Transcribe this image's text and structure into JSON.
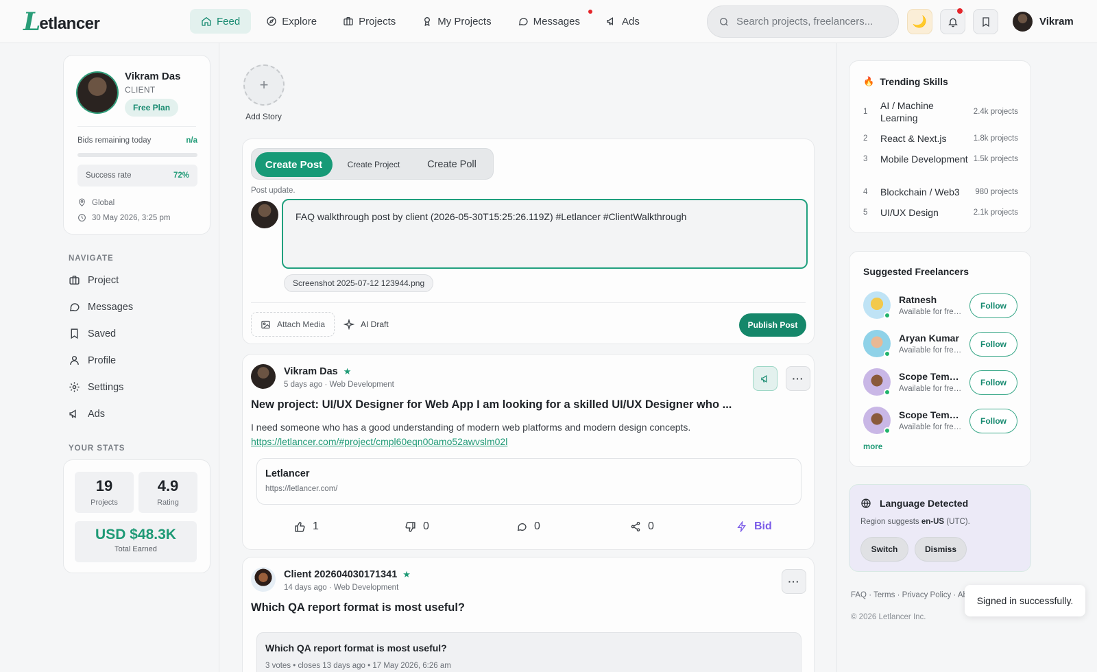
{
  "brand": {
    "logo_initial": "L",
    "logo_rest": "etlancer"
  },
  "nav": {
    "items": [
      {
        "label": "Feed",
        "icon": "home-icon",
        "active": true
      },
      {
        "label": "Explore",
        "icon": "compass-icon"
      },
      {
        "label": "Projects",
        "icon": "briefcase-icon"
      },
      {
        "label": "My Projects",
        "icon": "award-icon"
      },
      {
        "label": "Messages",
        "icon": "chat-icon",
        "has_dot": true
      },
      {
        "label": "Ads",
        "icon": "megaphone-icon"
      }
    ]
  },
  "search": {
    "placeholder": "Search projects, freelancers..."
  },
  "user": {
    "short_name": "Vikram"
  },
  "profile": {
    "name": "Vikram Das",
    "role": "CLIENT",
    "plan": "Free Plan",
    "bids_label": "Bids remaining today",
    "bids_value": "n/a",
    "success_label": "Success rate",
    "success_value": "72%",
    "location": "Global",
    "datetime": "30 May 2026, 3:25 pm"
  },
  "side_nav": {
    "label": "NAVIGATE",
    "items": [
      {
        "label": "Project",
        "icon": "briefcase-icon"
      },
      {
        "label": "Messages",
        "icon": "chat-icon"
      },
      {
        "label": "Saved",
        "icon": "bookmark-icon"
      },
      {
        "label": "Profile",
        "icon": "user-icon"
      },
      {
        "label": "Settings",
        "icon": "gear-icon"
      },
      {
        "label": "Ads",
        "icon": "megaphone-icon"
      }
    ]
  },
  "stats": {
    "label": "YOUR STATS",
    "projects_value": "19",
    "projects_label": "Projects",
    "rating_value": "4.9",
    "rating_label": "Rating",
    "earned_value": "USD $48.3K",
    "earned_label": "Total Earned"
  },
  "story": {
    "plus": "+",
    "label": "Add Story"
  },
  "composer": {
    "tabs": [
      "Create Post",
      "Create Project",
      "Create Poll"
    ],
    "hint": "Post update.",
    "text": "FAQ walkthrough post by client (2026-05-30T15:25:26.119Z) #Letlancer #ClientWalkthrough",
    "attachment": "Screenshot 2025-07-12 123944.png",
    "attach_media": "Attach Media",
    "ai_draft": "AI Draft",
    "publish": "Publish Post"
  },
  "posts": [
    {
      "author": "Vikram Das",
      "meta": "5 days ago · Web Development",
      "title": "New project: UI/UX Designer for Web App I am looking for a skilled UI/UX Designer who ...",
      "body": "I need someone who has a good understanding of modern web platforms and modern design concepts.",
      "link": "https://letlancer.com/#project/cmpl60eqn00amo52awvslm02l",
      "preview_title": "Letlancer",
      "preview_url": "https://letlancer.com/",
      "likes": "1",
      "dislikes": "0",
      "comments": "0",
      "shares": "0",
      "bid_label": "Bid"
    },
    {
      "author": "Client 202604030171341",
      "meta": "14 days ago · Web Development",
      "title": "Which QA report format is most useful?",
      "poll_title": "Which QA report format is most useful?",
      "poll_meta": "3 votes • closes 13 days ago • 17 May 2026, 6:26 am"
    }
  ],
  "trending": {
    "title": "Trending Skills",
    "items": [
      {
        "rank": "1",
        "skill": "AI / Machine Learning",
        "count": "2.4k projects"
      },
      {
        "rank": "2",
        "skill": "React & Next.js",
        "count": "1.8k projects"
      },
      {
        "rank": "3",
        "skill": "Mobile Development",
        "count": "1.5k projects"
      },
      {
        "rank": "4",
        "skill": "Blockchain / Web3",
        "count": "980 projects"
      },
      {
        "rank": "5",
        "skill": "UI/UX Design",
        "count": "2.1k projects"
      }
    ]
  },
  "suggested": {
    "title": "Suggested Freelancers",
    "items": [
      {
        "name": "Ratnesh",
        "status": "Available for freelance",
        "follow": "Follow"
      },
      {
        "name": "Aryan Kumar",
        "status": "Available for freelance",
        "follow": "Follow"
      },
      {
        "name": "Scope Template",
        "status": "Available for freelance",
        "follow": "Follow"
      },
      {
        "name": "Scope Template",
        "status": "Available for freelance",
        "follow": "Follow"
      }
    ],
    "more": "more"
  },
  "language": {
    "title": "Language Detected",
    "suggest_prefix": "Region suggests ",
    "locale": "en-US",
    "suggest_suffix": " (UTC).",
    "switch": "Switch",
    "dismiss": "Dismiss"
  },
  "footer": {
    "faq": "FAQ",
    "terms": "Terms",
    "privacy": "Privacy Policy",
    "about": "About",
    "sep": "·",
    "copyright": "© 2026 Letlancer Inc."
  },
  "toast": "Signed in successfully.",
  "colors": {
    "accent": "#179a77",
    "bid": "#7b5ce8",
    "badge": "#e5262b"
  }
}
